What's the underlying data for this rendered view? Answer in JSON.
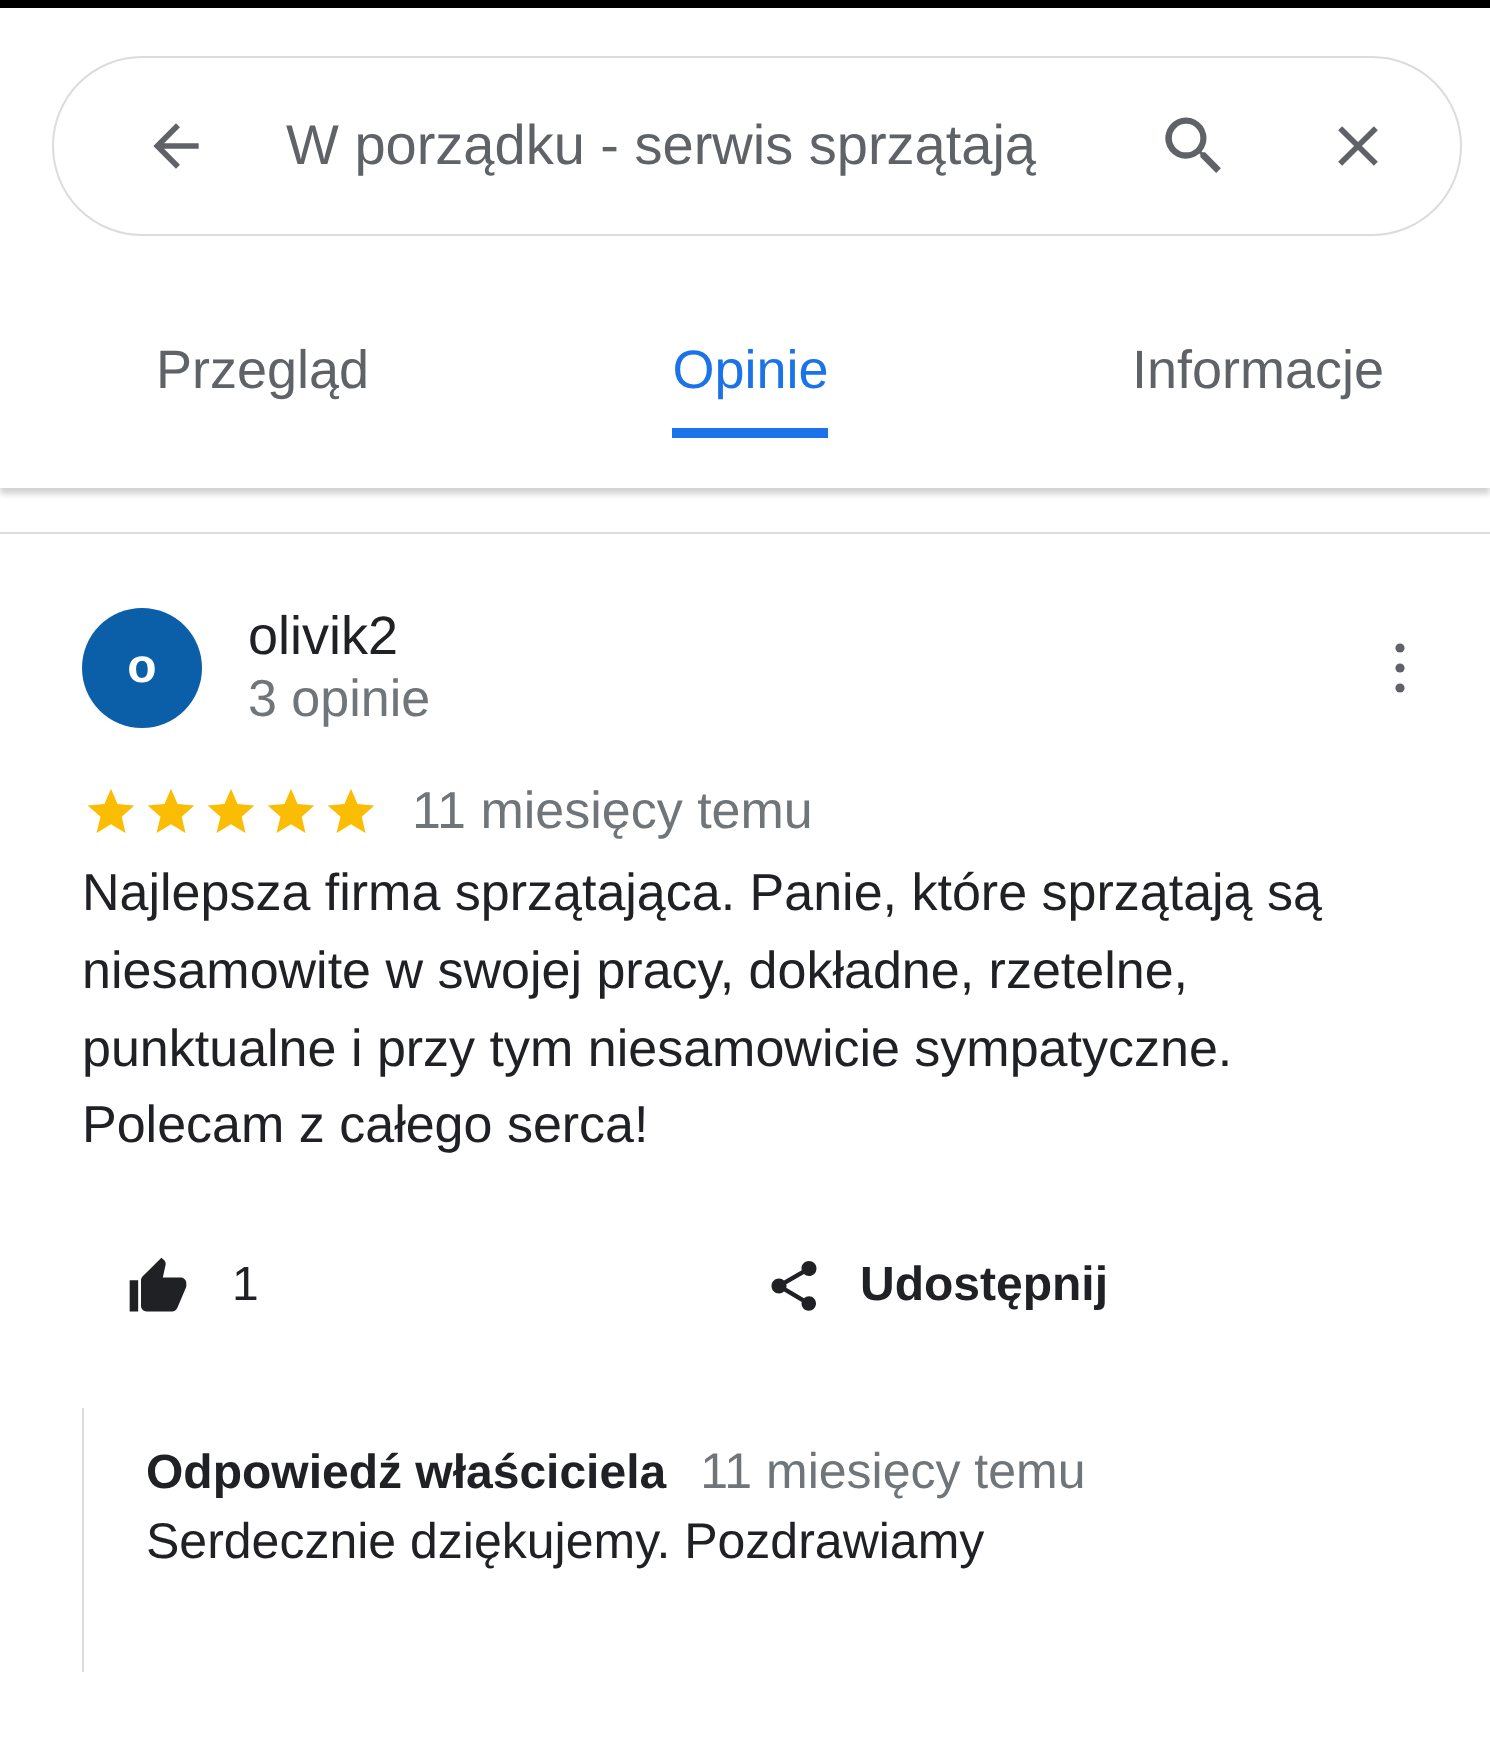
{
  "search": {
    "value": "W porządku - serwis sprzątają"
  },
  "tabs": [
    {
      "label": "Przegląd",
      "selected": false
    },
    {
      "label": "Opinie",
      "selected": true
    },
    {
      "label": "Informacje",
      "selected": false
    }
  ],
  "review": {
    "avatar_letter": "o",
    "author": "olivik2",
    "author_meta": "3 opinie",
    "stars": 5,
    "time": "11 miesięcy temu",
    "text": "Najlepsza firma sprzątająca. Panie, które sprzątają są niesamowite w swojej pracy, dokładne, rzetelne, punktualne i przy tym niesamowicie sympatyczne. Polecam z całego serca!",
    "likes": "1",
    "share_label": "Udostępnij",
    "owner_reply": {
      "title": "Odpowiedź właściciela",
      "time": "11 miesięcy temu",
      "text": "Serdecznie dziękujemy. Pozdrawiamy"
    }
  }
}
